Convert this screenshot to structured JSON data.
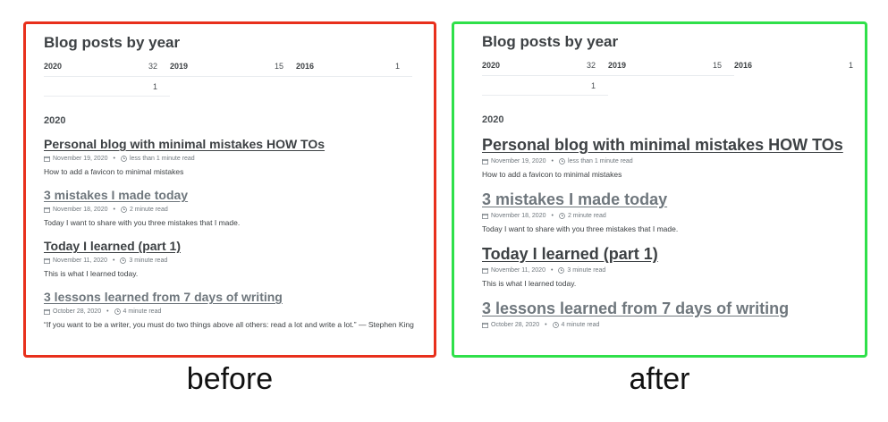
{
  "panels": {
    "before": {
      "page_title": "Blog posts by year",
      "years": [
        {
          "label": "2020",
          "count": "32"
        },
        {
          "label": "2019",
          "count": "15"
        },
        {
          "label": "2016",
          "count": "1"
        },
        {
          "label": "",
          "count": "1"
        }
      ],
      "section_year": "2020",
      "posts": [
        {
          "title": "Personal blog with minimal mistakes HOW TOs",
          "date": "November 19, 2020",
          "read_time": "less than 1 minute read",
          "excerpt": "How to add a favicon to minimal mistakes"
        },
        {
          "title": "3 mistakes I made today",
          "date": "November 18, 2020",
          "read_time": "2 minute read",
          "excerpt": "Today I want to share with you three mistakes that I made."
        },
        {
          "title": "Today I learned (part 1)",
          "date": "November 11, 2020",
          "read_time": "3 minute read",
          "excerpt": "This is what I learned today."
        },
        {
          "title": "3 lessons learned from 7 days of writing",
          "date": "October 28, 2020",
          "read_time": "4 minute read",
          "excerpt": "“If you want to be a writer, you must do two things above all others: read a lot and write a lot.” — Stephen King"
        }
      ]
    },
    "after": {
      "page_title": "Blog posts by year",
      "years": [
        {
          "label": "2020",
          "count": "32"
        },
        {
          "label": "2019",
          "count": "15"
        },
        {
          "label": "2016",
          "count": "1"
        },
        {
          "label": "",
          "count": "1"
        }
      ],
      "section_year": "2020",
      "posts": [
        {
          "title": "Personal blog with minimal mistakes HOW TOs",
          "date": "November 19, 2020",
          "read_time": "less than 1 minute read",
          "excerpt": "How to add a favicon to minimal mistakes"
        },
        {
          "title": "3 mistakes I made today",
          "date": "November 18, 2020",
          "read_time": "2 minute read",
          "excerpt": "Today I want to share with you three mistakes that I made."
        },
        {
          "title": "Today I learned (part 1)",
          "date": "November 11, 2020",
          "read_time": "3 minute read",
          "excerpt": "This is what I learned today."
        },
        {
          "title": "3 lessons learned from 7 days of writing",
          "date": "October 28, 2020",
          "read_time": "4 minute read",
          "excerpt": ""
        }
      ]
    }
  },
  "captions": {
    "before": "before",
    "after": "after"
  },
  "colors": {
    "before_border": "#e8301c",
    "after_border": "#2fe04a",
    "text": "#3d4144",
    "muted": "#6f777d"
  },
  "icons": {
    "date": "calendar-icon",
    "read_time": "clock-icon"
  }
}
